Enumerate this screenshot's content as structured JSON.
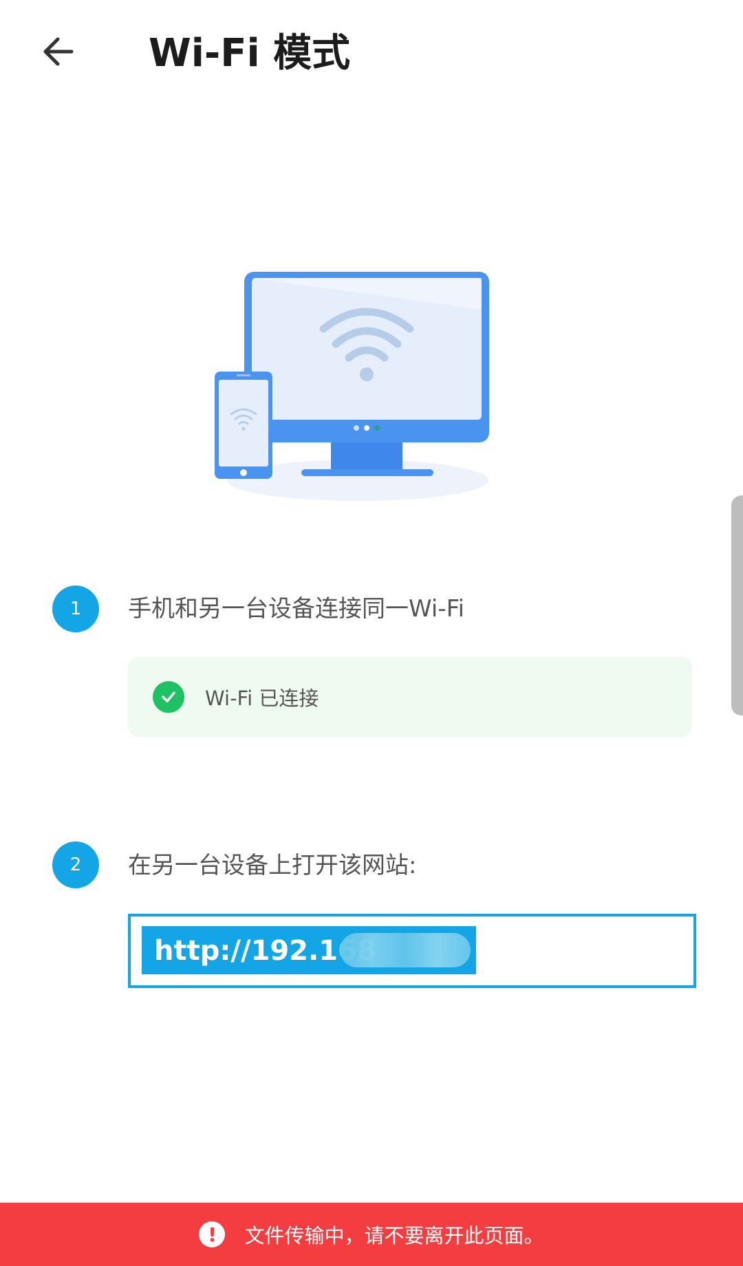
{
  "header": {
    "title": "Wi-Fi 模式",
    "back_icon": "arrow-left-icon"
  },
  "illustration": {
    "icon": "monitor-phone-wifi-illustration",
    "accent": "#4a94f0"
  },
  "steps": [
    {
      "number": "1",
      "text": "手机和另一台设备连接同一Wi-Fi"
    },
    {
      "number": "2",
      "text": "在另一台设备上打开该网站:"
    }
  ],
  "wifi_status": {
    "icon": "check-circle-icon",
    "text": "Wi-Fi 已连接",
    "color": "#1ec262"
  },
  "url": {
    "value": "http://192.168"
  },
  "warning": {
    "icon": "exclamation-icon",
    "text": "文件传输中，请不要离开此页面。",
    "color": "#f33d41"
  },
  "colors": {
    "accent": "#13a5e6"
  }
}
